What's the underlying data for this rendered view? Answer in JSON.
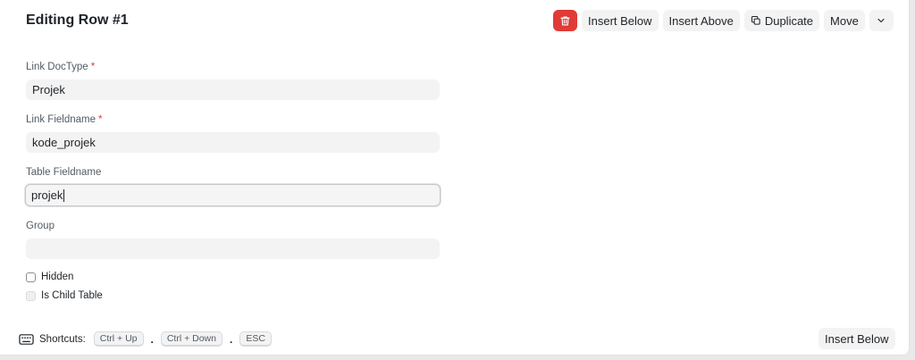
{
  "header": {
    "title": "Editing Row #1"
  },
  "toolbar": {
    "delete_icon": "trash-icon",
    "insert_below_label": "Insert Below",
    "insert_above_label": "Insert Above",
    "duplicate_icon": "duplicate-icon",
    "duplicate_label": "Duplicate",
    "move_label": "Move",
    "more_icon": "chevron-down-icon"
  },
  "fields": {
    "link_doctype": {
      "label": "Link DocType",
      "required_mark": "*",
      "value": "Projek"
    },
    "link_fieldname": {
      "label": "Link Fieldname",
      "required_mark": "*",
      "value": "kode_projek"
    },
    "table_fieldname": {
      "label": "Table Fieldname",
      "value": "projek"
    },
    "group": {
      "label": "Group",
      "value": ""
    }
  },
  "checkboxes": {
    "hidden": {
      "label": "Hidden",
      "checked": false
    },
    "is_child_table": {
      "label": "Is Child Table",
      "checked": false,
      "disabled": true
    }
  },
  "footer": {
    "shortcuts_icon": "keyboard-icon",
    "shortcuts_label": "Shortcuts:",
    "keys": [
      "Ctrl + Up",
      "Ctrl + Down",
      "ESC"
    ],
    "separator": ".",
    "insert_below_label": "Insert Below"
  },
  "colors": {
    "danger": "#e03b36",
    "button_bg": "#f3f3f3",
    "input_bg": "#f3f3f3",
    "text": "#1f2328",
    "label": "#525b64"
  }
}
